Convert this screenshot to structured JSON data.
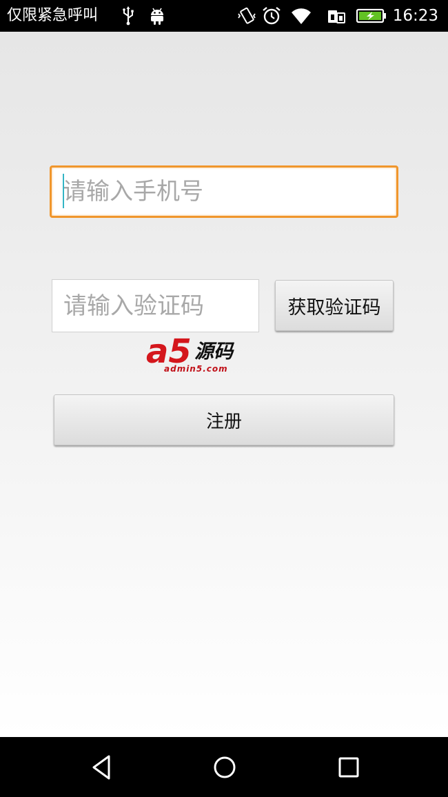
{
  "status_bar": {
    "carrier_text": "仅限紧急呼叫",
    "time": "16:23",
    "icons": [
      "usb-icon",
      "android-debug-icon",
      "vibrate-icon",
      "alarm-icon",
      "wifi-icon",
      "sim-icon",
      "battery-charging-icon"
    ]
  },
  "form": {
    "phone_placeholder": "请输入手机号",
    "phone_value": "",
    "code_placeholder": "请输入验证码",
    "code_value": "",
    "get_code_label": "获取验证码",
    "register_label": "注册"
  },
  "watermark": {
    "logo_mark": "a5",
    "logo_cn": "源码",
    "logo_url": "admin5.com"
  },
  "nav_bar": {
    "icons": [
      "back-icon",
      "home-icon",
      "recents-icon"
    ]
  },
  "colors": {
    "focus_border": "#f0962c",
    "caret": "#33b5c5",
    "watermark_red": "#d4161c"
  }
}
